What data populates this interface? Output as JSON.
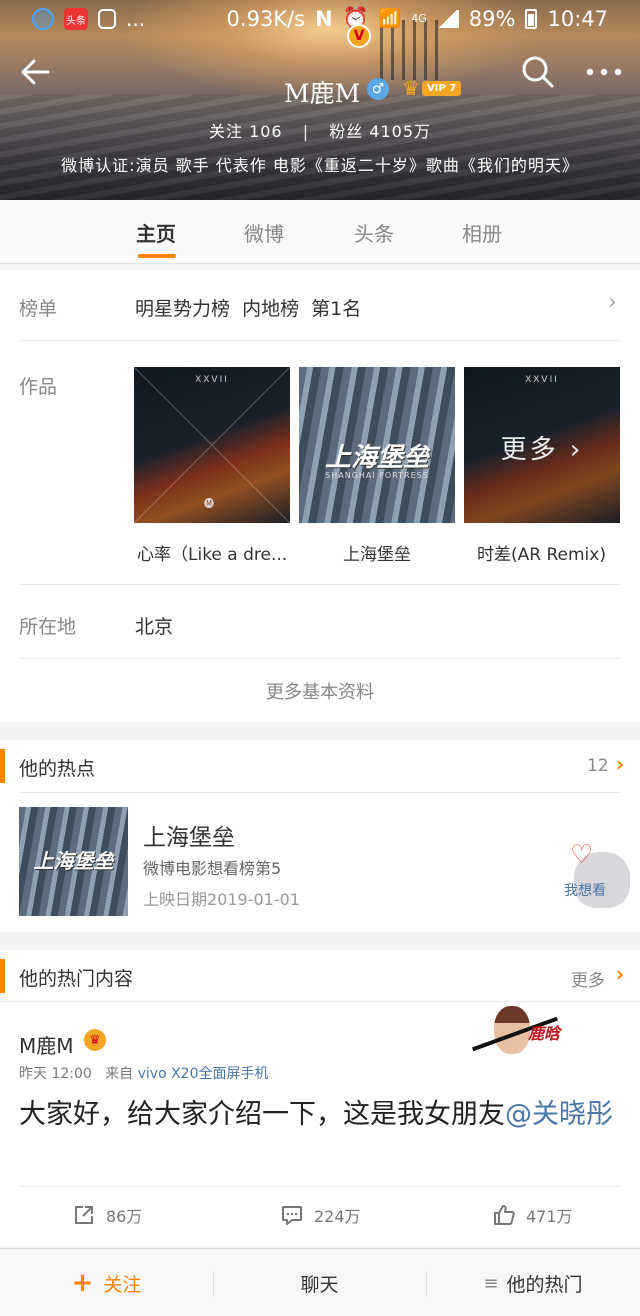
{
  "status_bar": {
    "app_icon_headline": "头条",
    "ellipsis": "...",
    "net_speed": "0.93K/s",
    "network": "4G",
    "battery": "89%",
    "time": "10:47"
  },
  "profile": {
    "name": "M鹿M",
    "avatar_badge": "V",
    "gender_symbol": "♂",
    "vip_label": "VIP 7",
    "follow_label": "关注",
    "follow_count": "106",
    "separator": "|",
    "fans_label": "粉丝",
    "fans_count": "4105万",
    "verification": "微博认证:演员 歌手 代表作 电影《重返二十岁》歌曲《我们的明天》"
  },
  "tabs": [
    {
      "label": "主页",
      "active": true
    },
    {
      "label": "微博",
      "active": false
    },
    {
      "label": "头条",
      "active": false
    },
    {
      "label": "相册",
      "active": false
    }
  ],
  "info": {
    "ranking_label": "榜单",
    "ranking_value": "明星势力榜  内地榜  第1名",
    "works_label": "作品",
    "works": [
      {
        "title": "心率（Like a dre...",
        "cover_tag": "XXVII",
        "cover_mark": "🅜"
      },
      {
        "title": "上海堡垒",
        "cover_logo": "上海堡垒",
        "cover_sub": "SHANGHAI FORTRESS"
      },
      {
        "title": "时差(AR Remix)",
        "cover_tag": "XXVII",
        "overlay": "更多 ›"
      }
    ],
    "location_label": "所在地",
    "location_value": "北京",
    "more_info": "更多基本资料"
  },
  "hot_point": {
    "title": "他的热点",
    "count": "12",
    "movie_title": "上海堡垒",
    "movie_rank": "微博电影想看榜第5",
    "movie_date": "上映日期2019-01-01",
    "thumb_logo": "上海堡垒",
    "want_label": "我想看"
  },
  "hot_content": {
    "title": "他的热门内容",
    "more": "更多",
    "poster": "M鹿M",
    "time": "昨天 12:00",
    "from_label": "来自",
    "source": "vivo X20全面屏手机",
    "text": "大家好，给大家介绍一下，这是我女朋友",
    "mention": "@关晓彤",
    "repost_count": "86万",
    "comment_count": "224万",
    "like_count": "471万"
  },
  "bottom_bar": {
    "follow": "关注",
    "chat": "聊天",
    "hot": "他的热门"
  },
  "colors": {
    "accent": "#ff8200",
    "link": "#4a76a8",
    "vip_gold": "#f5a623"
  }
}
